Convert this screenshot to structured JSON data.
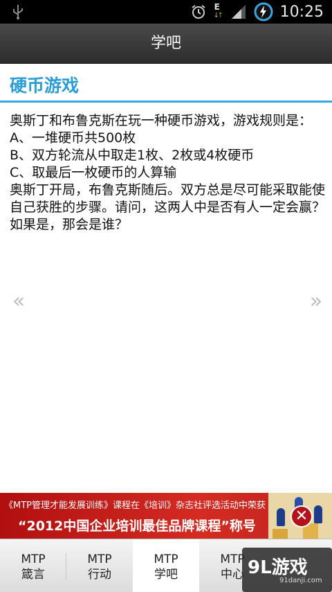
{
  "status_bar": {
    "time": "10:25",
    "network_label": "E",
    "icons": [
      "usb-icon",
      "alarm-icon",
      "data-arrows-icon",
      "signal-icon",
      "battery-charging-icon"
    ]
  },
  "header": {
    "title": "学吧"
  },
  "section": {
    "title": "硬币游戏"
  },
  "content": {
    "lines": [
      "奥斯丁和布鲁克斯在玩一种硬币游戏，游戏规则是：",
      "A、一堆硬币共500枚",
      "B、双方轮流从中取走1枚、2枚或4枚硬币",
      "C、取最后一枚硬币的人算输",
      "奥斯丁开局，布鲁克斯随后。双方总是尽可能采取能使自己获胜的步骤。请问，这两人中是否有人一定会赢？如果是，那会是谁？"
    ]
  },
  "navigation": {
    "prev_symbol": "«",
    "next_symbol": "»"
  },
  "banner": {
    "line1": "《MTP管理才能发展训练》课程在《培训》杂志社评选活动中荣获",
    "line2": "“2012中国企业培训最佳品牌课程”称号",
    "close_symbol": "✕"
  },
  "tabs": [
    {
      "line1": "MTP",
      "line2": "箴言",
      "active": false
    },
    {
      "line1": "MTP",
      "line2": "行动",
      "active": false
    },
    {
      "line1": "MTP",
      "line2": "学吧",
      "active": true
    },
    {
      "line1": "MTP",
      "line2": "中心",
      "active": false
    }
  ],
  "watermark": {
    "main": "9L游戏",
    "sub": "91danji.com"
  }
}
